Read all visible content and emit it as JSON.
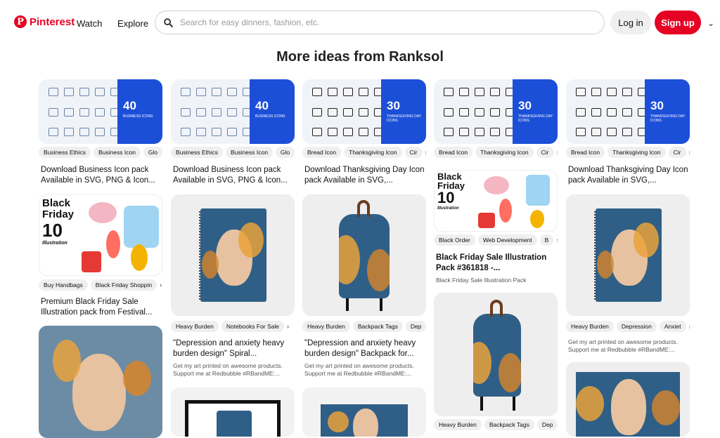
{
  "header": {
    "logo_text": "Pinterest",
    "nav_watch": "Watch",
    "nav_explore": "Explore",
    "search_placeholder": "Search for easy dinners, fashion, etc.",
    "login_label": "Log in",
    "signup_label": "Sign up"
  },
  "section_title": "More ideas from Ranksol",
  "pins": {
    "p1": {
      "tags": [
        "Business Ethics",
        "Business Icon",
        "Glo"
      ],
      "title": "Download Business Icon pack Available in SVG, PNG & Icon...",
      "number": "40",
      "subtitle": "BUSINESS ICONS"
    },
    "p2": {
      "tags": [
        "Business Ethics",
        "Business Icon",
        "Glo"
      ],
      "title": "Download Business Icon pack Available in SVG, PNG & Icon...",
      "number": "40",
      "subtitle": "BUSINESS ICONS"
    },
    "p3": {
      "tags": [
        "Bread Icon",
        "Thanksgiving Icon",
        "Cir"
      ],
      "title": "Download Thanksgiving Day Icon pack Available in SVG,...",
      "number": "30",
      "subtitle": "THANKSGIVING DAY ICONS"
    },
    "p4": {
      "tags": [
        "Bread Icon",
        "Thanksgiving Icon",
        "Cir"
      ],
      "number": "30",
      "subtitle": "THANKSGIVING DAY ICONS"
    },
    "p5": {
      "tags": [
        "Bread Icon",
        "Thanksgiving Icon",
        "Cir"
      ],
      "title": "Download Thanksgiving Day Icon pack Available in SVG,...",
      "number": "30",
      "subtitle": "THANKSGIVING DAY ICONS"
    },
    "p6": {
      "tags": [
        "Buy Handbags",
        "Black Friday Shoppin"
      ],
      "title": "Premium Black Friday Sale Illustration pack from Festival...",
      "art_lines": [
        "Black",
        "Friday",
        "10",
        "Illustration"
      ]
    },
    "p7": {
      "tags": [
        "Heavy Burden",
        "Notebooks For Sale"
      ],
      "title": "\"Depression and anxiety heavy burden design\" Spiral...",
      "desc": "Get my art printed on awesome products. Support me at Redbubble #RBandME:..."
    },
    "p8": {
      "tags": [
        "Heavy Burden",
        "Backpack Tags",
        "Dep"
      ],
      "title": "\"Depression and anxiety heavy burden design\" Backpack for...",
      "desc": "Get my art printed on awesome products. Support me at Redbubble #RBandME:..."
    },
    "p9": {
      "tags": [
        "Black Order",
        "Web Development",
        "B"
      ],
      "title": "Black Friday Sale Illustration Pack #361818 -...",
      "desc": "Black Friday Sale Illustration Pack",
      "art_lines": [
        "Black",
        "Friday",
        "10",
        "Illustration"
      ]
    },
    "p10": {
      "tags": [
        "Heavy Burden",
        "Depression",
        "Anxiet"
      ],
      "desc": "Get my art printed on awesome products. Support me at Redbubble #RBandME:..."
    },
    "p11": {
      "tags": [
        "Heavy Burden",
        "Backpack Tags",
        "Dep"
      ]
    }
  },
  "colors": {
    "brand": "#e60023",
    "icon_panel": "#1c4fd8"
  }
}
